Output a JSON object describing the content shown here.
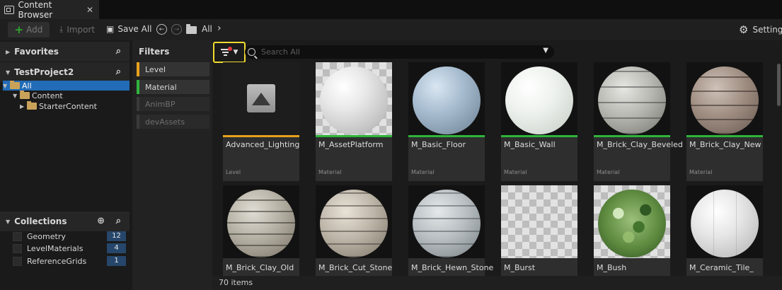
{
  "tab": {
    "title": "Content Browser",
    "close_glyph": "✕",
    "icon": "content-browser-icon"
  },
  "toolbar": {
    "add_label": "Add",
    "import_label": "Import",
    "save_all_label": "Save All",
    "breadcrumb": "All",
    "settings_label": "Settings"
  },
  "left": {
    "favorites_label": "Favorites",
    "project_label": "TestProject2",
    "tree": [
      {
        "label": "All",
        "selected": true
      },
      {
        "label": "Content",
        "selected": false
      },
      {
        "label": "StarterContent",
        "selected": false
      }
    ],
    "collections_label": "Collections",
    "collections": [
      {
        "label": "Geometry",
        "count": "12"
      },
      {
        "label": "LevelMaterials",
        "count": "4"
      },
      {
        "label": "ReferenceGrids",
        "count": "1"
      }
    ]
  },
  "filters": {
    "title": "Filters",
    "chips": [
      {
        "label": "Level",
        "active": true,
        "color": "#e6a11c"
      },
      {
        "label": "Material",
        "active": true,
        "color": "#2fb53c"
      },
      {
        "label": "AnimBP",
        "active": false,
        "color": "#3a3a3a"
      },
      {
        "label": "devAssets",
        "active": false,
        "color": "#3a3a3a"
      }
    ]
  },
  "search": {
    "placeholder": "Search All"
  },
  "assets": [
    {
      "name": "Advanced_Lighting",
      "type": "Level",
      "bar": "#e6a11c"
    },
    {
      "name": "M_AssetPlatform",
      "type": "Material",
      "bar": "#2fb53c"
    },
    {
      "name": "M_Basic_Floor",
      "type": "Material",
      "bar": "#2fb53c"
    },
    {
      "name": "M_Basic_Wall",
      "type": "Material",
      "bar": "#2fb53c"
    },
    {
      "name": "M_Brick_Clay_Beveled",
      "type": "Material",
      "bar": "#2fb53c"
    },
    {
      "name": "M_Brick_Clay_New",
      "type": "Material",
      "bar": "#2fb53c"
    },
    {
      "name": "M_Brick_Clay_Old",
      "type": "",
      "bar": "#2fb53c"
    },
    {
      "name": "M_Brick_Cut_Stone",
      "type": "",
      "bar": "#2fb53c"
    },
    {
      "name": "M_Brick_Hewn_Stone",
      "type": "",
      "bar": "#2fb53c"
    },
    {
      "name": "M_Burst",
      "type": "",
      "bar": "#2fb53c"
    },
    {
      "name": "M_Bush",
      "type": "",
      "bar": "#2fb53c"
    },
    {
      "name": "M_Ceramic_Tile_",
      "type": "",
      "bar": "#2fb53c"
    }
  ],
  "footer": {
    "item_count": "70 items"
  }
}
